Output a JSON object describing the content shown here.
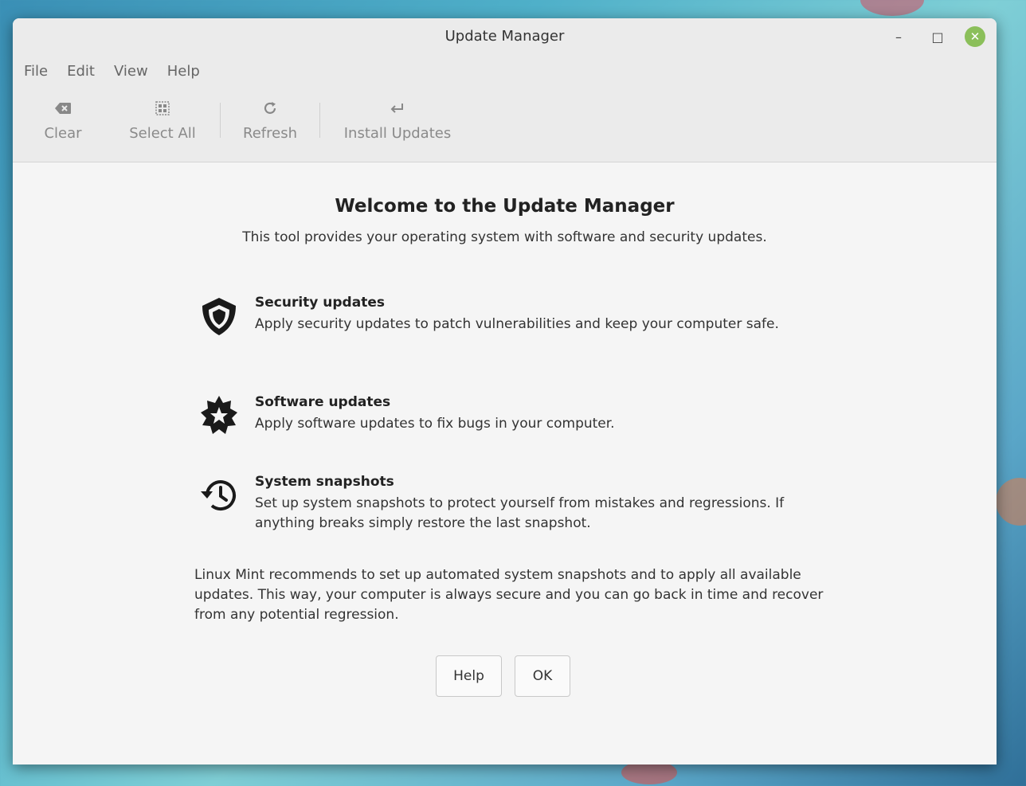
{
  "window": {
    "title": "Update Manager",
    "controls": {
      "minimize": "–",
      "maximize": "□",
      "close": "✕"
    }
  },
  "menubar": [
    "File",
    "Edit",
    "View",
    "Help"
  ],
  "toolbar": {
    "clear": {
      "label": "Clear",
      "icon": "backspace-icon"
    },
    "select_all": {
      "label": "Select All",
      "icon": "select-all-icon"
    },
    "refresh": {
      "label": "Refresh",
      "icon": "refresh-icon"
    },
    "install": {
      "label": "Install Updates",
      "icon": "return-arrow-icon"
    }
  },
  "welcome": {
    "heading": "Welcome to the Update Manager",
    "subtitle": "This tool provides your operating system with software and security updates."
  },
  "features": [
    {
      "title": "Security updates",
      "description": "Apply security updates to patch vulnerabilities and keep your computer safe.",
      "icon": "shield-icon"
    },
    {
      "title": "Software updates",
      "description": "Apply software updates to fix bugs in your computer.",
      "icon": "badge-star-icon"
    },
    {
      "title": "System snapshots",
      "description": "Set up system snapshots to protect yourself from mistakes and regressions. If anything breaks simply restore the last snapshot.",
      "icon": "history-icon"
    }
  ],
  "recommendation": "Linux Mint recommends to set up automated system snapshots and to apply all available updates. This way, your computer is always secure and you can go back in time and recover from any potential regression.",
  "buttons": {
    "help": "Help",
    "ok": "OK"
  },
  "colors": {
    "close_button": "#8bbf5a",
    "window_bg": "#f5f5f5",
    "header_bg": "#ebebeb"
  }
}
